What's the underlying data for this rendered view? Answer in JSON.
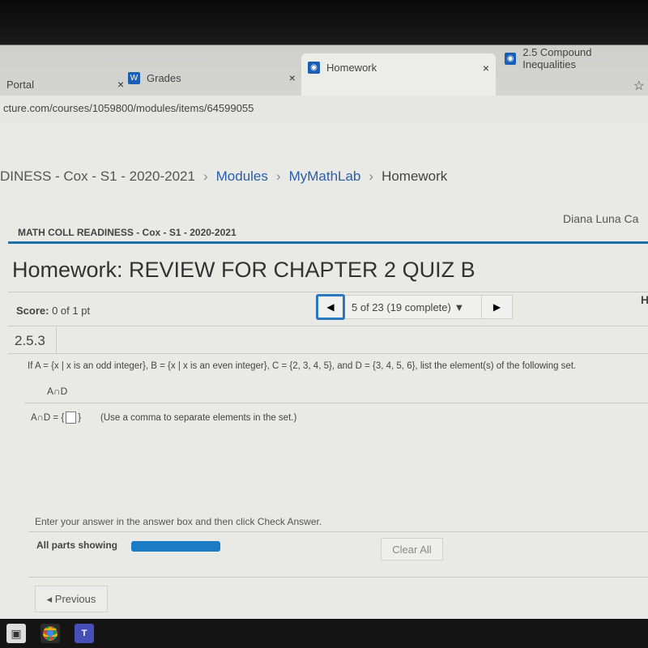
{
  "browser": {
    "tabs": [
      {
        "label": "Portal",
        "active": false
      },
      {
        "label": "Grades",
        "icon": "W",
        "active": false
      },
      {
        "label": "Homework",
        "active": true
      },
      {
        "label": "2.5 Compound Inequalities",
        "active": false
      }
    ],
    "close_glyph": "×",
    "url": "cture.com/courses/1059800/modules/items/64599055",
    "bookmark_glyph": "☆"
  },
  "breadcrumb": [
    "DINESS - Cox - S1 - 2020-2021",
    "Modules",
    "MyMathLab",
    "Homework"
  ],
  "breadcrumb_sep": "›",
  "course_name": "MATH COLL READINESS - Cox - S1 - 2020-2021",
  "user_name": "Diana Luna Ca",
  "title": "Homework: REVIEW FOR CHAPTER 2 QUIZ B",
  "score": {
    "label": "Score:",
    "value": "0 of 1 pt"
  },
  "question_nav": {
    "prev_glyph": "◀",
    "text": "5 of 23 (19 complete) ▼",
    "next_glyph": "▶"
  },
  "right_edge_letter": "H",
  "question": {
    "number": "2.5.3",
    "text": "If A = {x | x is an odd integer}, B = {x | x is an even integer}, C = {2, 3, 4, 5}, and D = {3, 4, 5, 6}, list the element(s) of the following set.",
    "expression": "A∩D",
    "answer_prefix": "A∩D = {",
    "answer_value": "",
    "answer_suffix": "}",
    "hint": "(Use a comma to separate elements in the set.)"
  },
  "instruction": "Enter your answer in the answer box and then click Check Answer.",
  "parts_label": "All parts showing",
  "parts_progress": 1.0,
  "clear_all": "Clear All",
  "previous": "◂ Previous",
  "colors": {
    "accent": "#1f6fa8",
    "progress": "#1a7cc4",
    "link": "#2a5ea8"
  }
}
